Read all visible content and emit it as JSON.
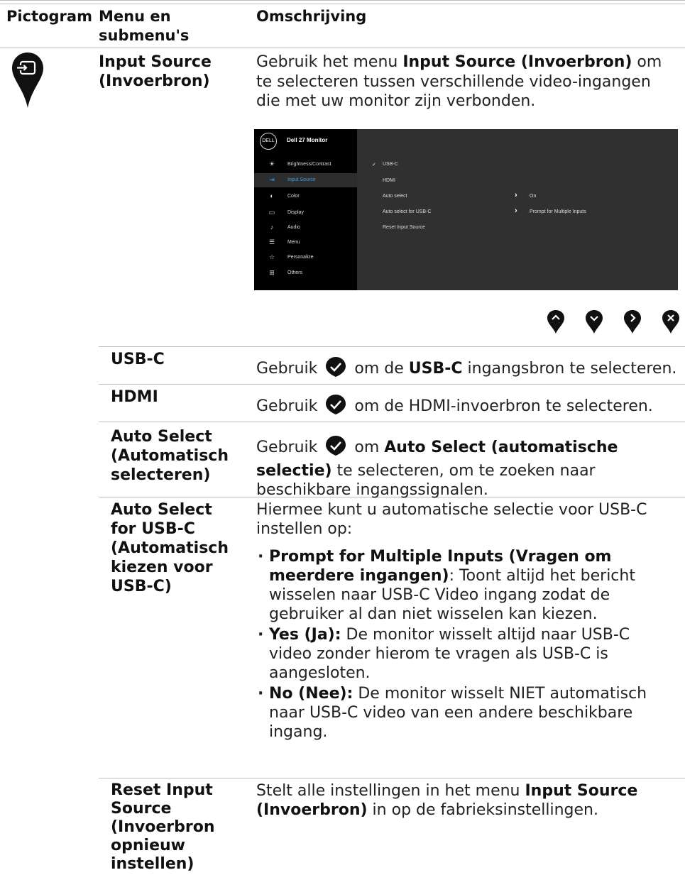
{
  "header": {
    "col1": "Pictogram",
    "col2": "Menu en submenu's",
    "col3": "Omschrijving"
  },
  "intro": {
    "menu_name": "Input Source (Invoerbron)",
    "text_pre": "Gebruik het menu ",
    "text_bold": "Input Source (Invoerbron)",
    "text_post": " om te selecteren tussen verschillende video-ingangen die met uw monitor zijn verbonden."
  },
  "osd": {
    "logo": "DELL",
    "title": "Dell 27 Monitor",
    "menu": [
      {
        "label": "Brightness/Contrast",
        "icon": "brightness-icon"
      },
      {
        "label": "Input Source",
        "icon": "input-source-icon"
      },
      {
        "label": "Color",
        "icon": "color-icon"
      },
      {
        "label": "Display",
        "icon": "display-icon"
      },
      {
        "label": "Audio",
        "icon": "audio-icon"
      },
      {
        "label": "Menu",
        "icon": "menu-icon"
      },
      {
        "label": "Personalize",
        "icon": "star-icon"
      },
      {
        "label": "Others",
        "icon": "others-icon"
      }
    ],
    "options": {
      "usbc": "USB-C",
      "hdmi": "HDMI",
      "auto_select": "Auto select",
      "auto_select_value": "On",
      "auto_select_usbc": "Auto select for USB-C",
      "auto_select_usbc_value": "Prompt for Multiple Inputs",
      "reset": "Reset Input Source"
    }
  },
  "nav_buttons": [
    "up-icon",
    "down-icon",
    "right-icon",
    "close-icon"
  ],
  "rows": {
    "usbc": {
      "name": "USB-C",
      "pre": "Gebruik ",
      "mid": " om de ",
      "bold": "USB-C",
      "post": " ingangsbron te selecteren."
    },
    "hdmi": {
      "name": "HDMI",
      "pre": "Gebruik ",
      "mid": " om de ",
      "bold": "HDMI",
      "post": "-invoerbron te selecteren."
    },
    "auto": {
      "name": "Auto Select (Automatisch selecteren)",
      "pre": "Gebruik ",
      "mid": " om ",
      "bold": "Auto Select (automatische selectie)",
      "post": " te selecteren, om te zoeken naar beschikbare ingangssignalen."
    },
    "auto_usbc": {
      "name": "Auto Select for USB-C (Automatisch kiezen voor USB-C)",
      "intro": "Hiermee kunt u automatische selectie voor USB-C instellen op:",
      "b1_bold": "Prompt for Multiple Inputs (Vragen om meerdere ingangen)",
      "b1_text": ": Toont altijd het bericht wisselen naar USB-C Video ingang zodat de gebruiker al dan niet wisselen kan kiezen.",
      "b2_bold": "Yes (Ja):",
      "b2_text": " De monitor wisselt altijd naar USB-C video zonder hierom te vragen als USB-C is aangesloten.",
      "b3_bold": "No (Nee):",
      "b3_text": " De monitor wisselt NIET automatisch naar USB-C video van een andere beschikbare ingang."
    },
    "reset": {
      "name": "Reset Input Source (Invoerbron opnieuw instellen)",
      "pre": "Stelt alle instellingen in het menu ",
      "bold": "Input Source (Invoerbron)",
      "post": " in op de fabrieksinstellingen."
    }
  },
  "colors": {
    "pin": "#111111",
    "check": "#ffffff",
    "osd_bg": "#303030",
    "osd_accent": "#3aa0f0"
  }
}
